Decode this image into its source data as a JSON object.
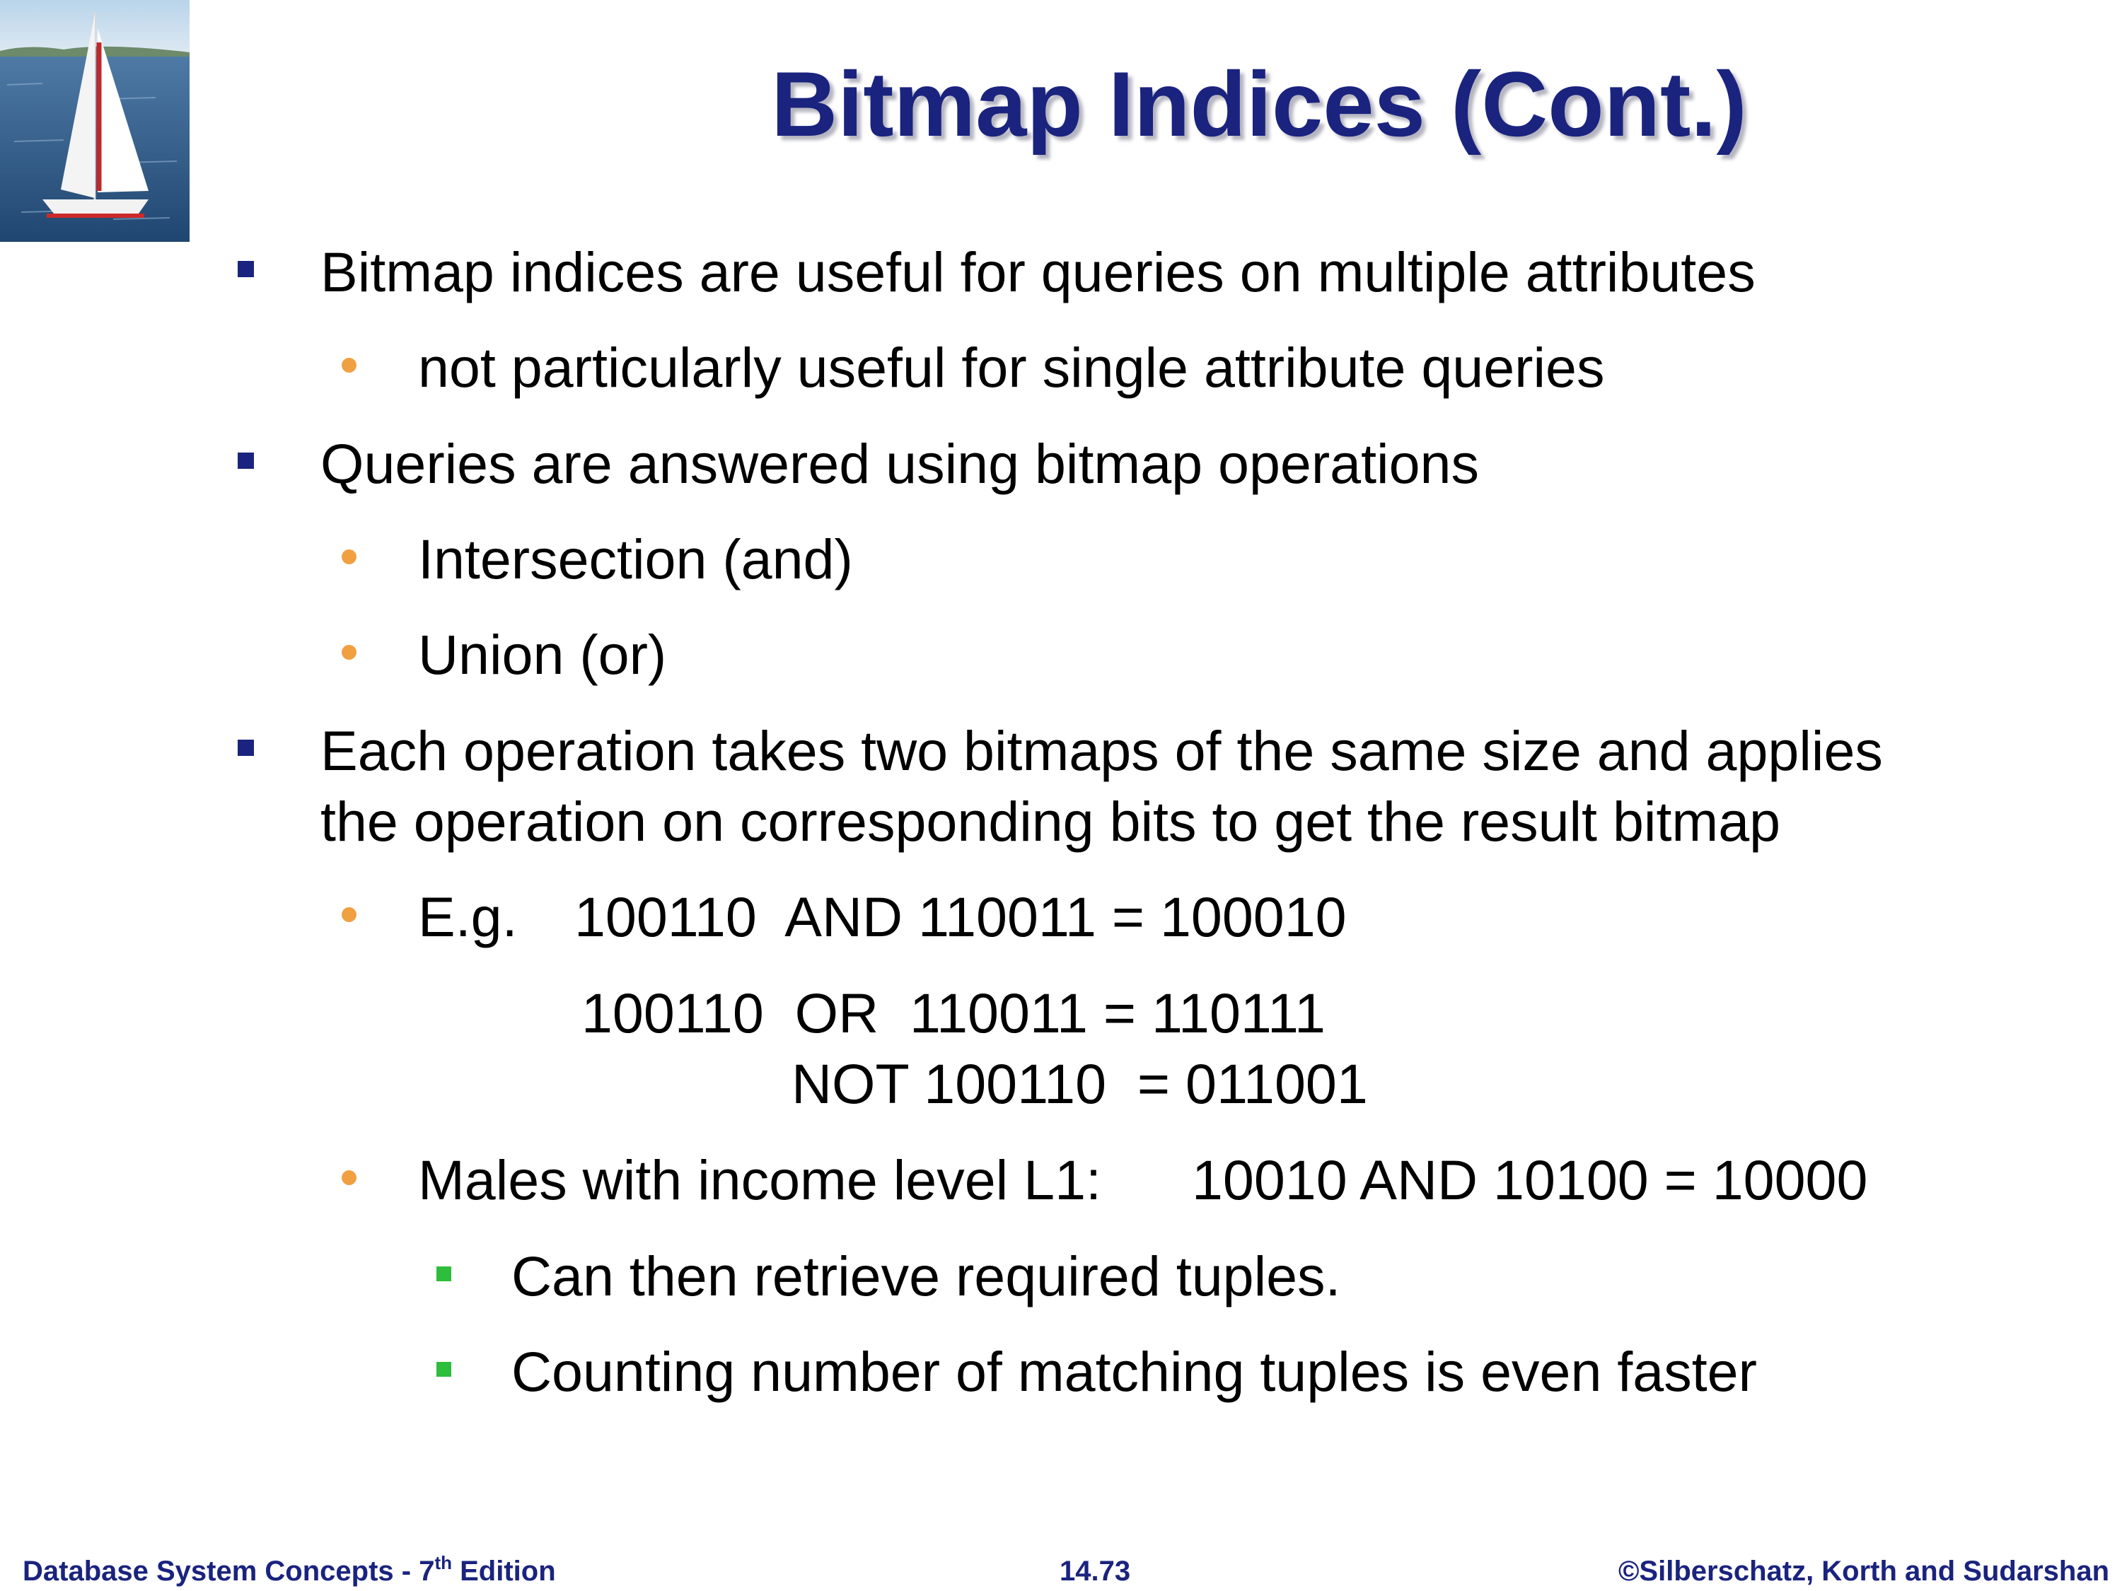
{
  "slide": {
    "title": "Bitmap Indices (Cont.)",
    "bullets": {
      "b1": "Bitmap indices are useful for queries on multiple attributes",
      "b1_1": "not particularly useful for single attribute queries",
      "b2": "Queries are answered using bitmap operations",
      "b2_1": "Intersection (and)",
      "b2_2": "Union (or)",
      "b3_line1": "Each operation takes two bitmaps of the same size and applies",
      "b3_line2": "the operation on corresponding bits to get the result bitmap",
      "b3_1_prefix": "E.g.",
      "b3_1_and": "100110  AND 110011 = 100010",
      "b3_1_or": "100110  OR  110011 = 110111",
      "b3_1_not": "NOT 100110  = 011001",
      "b3_2_label": "Males with income level L1:",
      "b3_2_expr": "10010 AND 10100 = 10000",
      "b3_2_1": "Can then retrieve required tuples.",
      "b3_2_2": "Counting number of matching tuples is even faster"
    }
  },
  "footer": {
    "left_prefix": "Database System Concepts - 7",
    "left_sup": "th",
    "left_suffix": " Edition",
    "center": "14.73",
    "right": "©Silberschatz, Korth and Sudarshan"
  },
  "colors": {
    "title": "#1a237e",
    "level1_bullet": "#1a237e",
    "level2_bullet": "#f0a040",
    "level3_bullet": "#2ebd3c",
    "footer": "#1a237e"
  },
  "icons": {
    "logo": "sailboat-photo"
  }
}
